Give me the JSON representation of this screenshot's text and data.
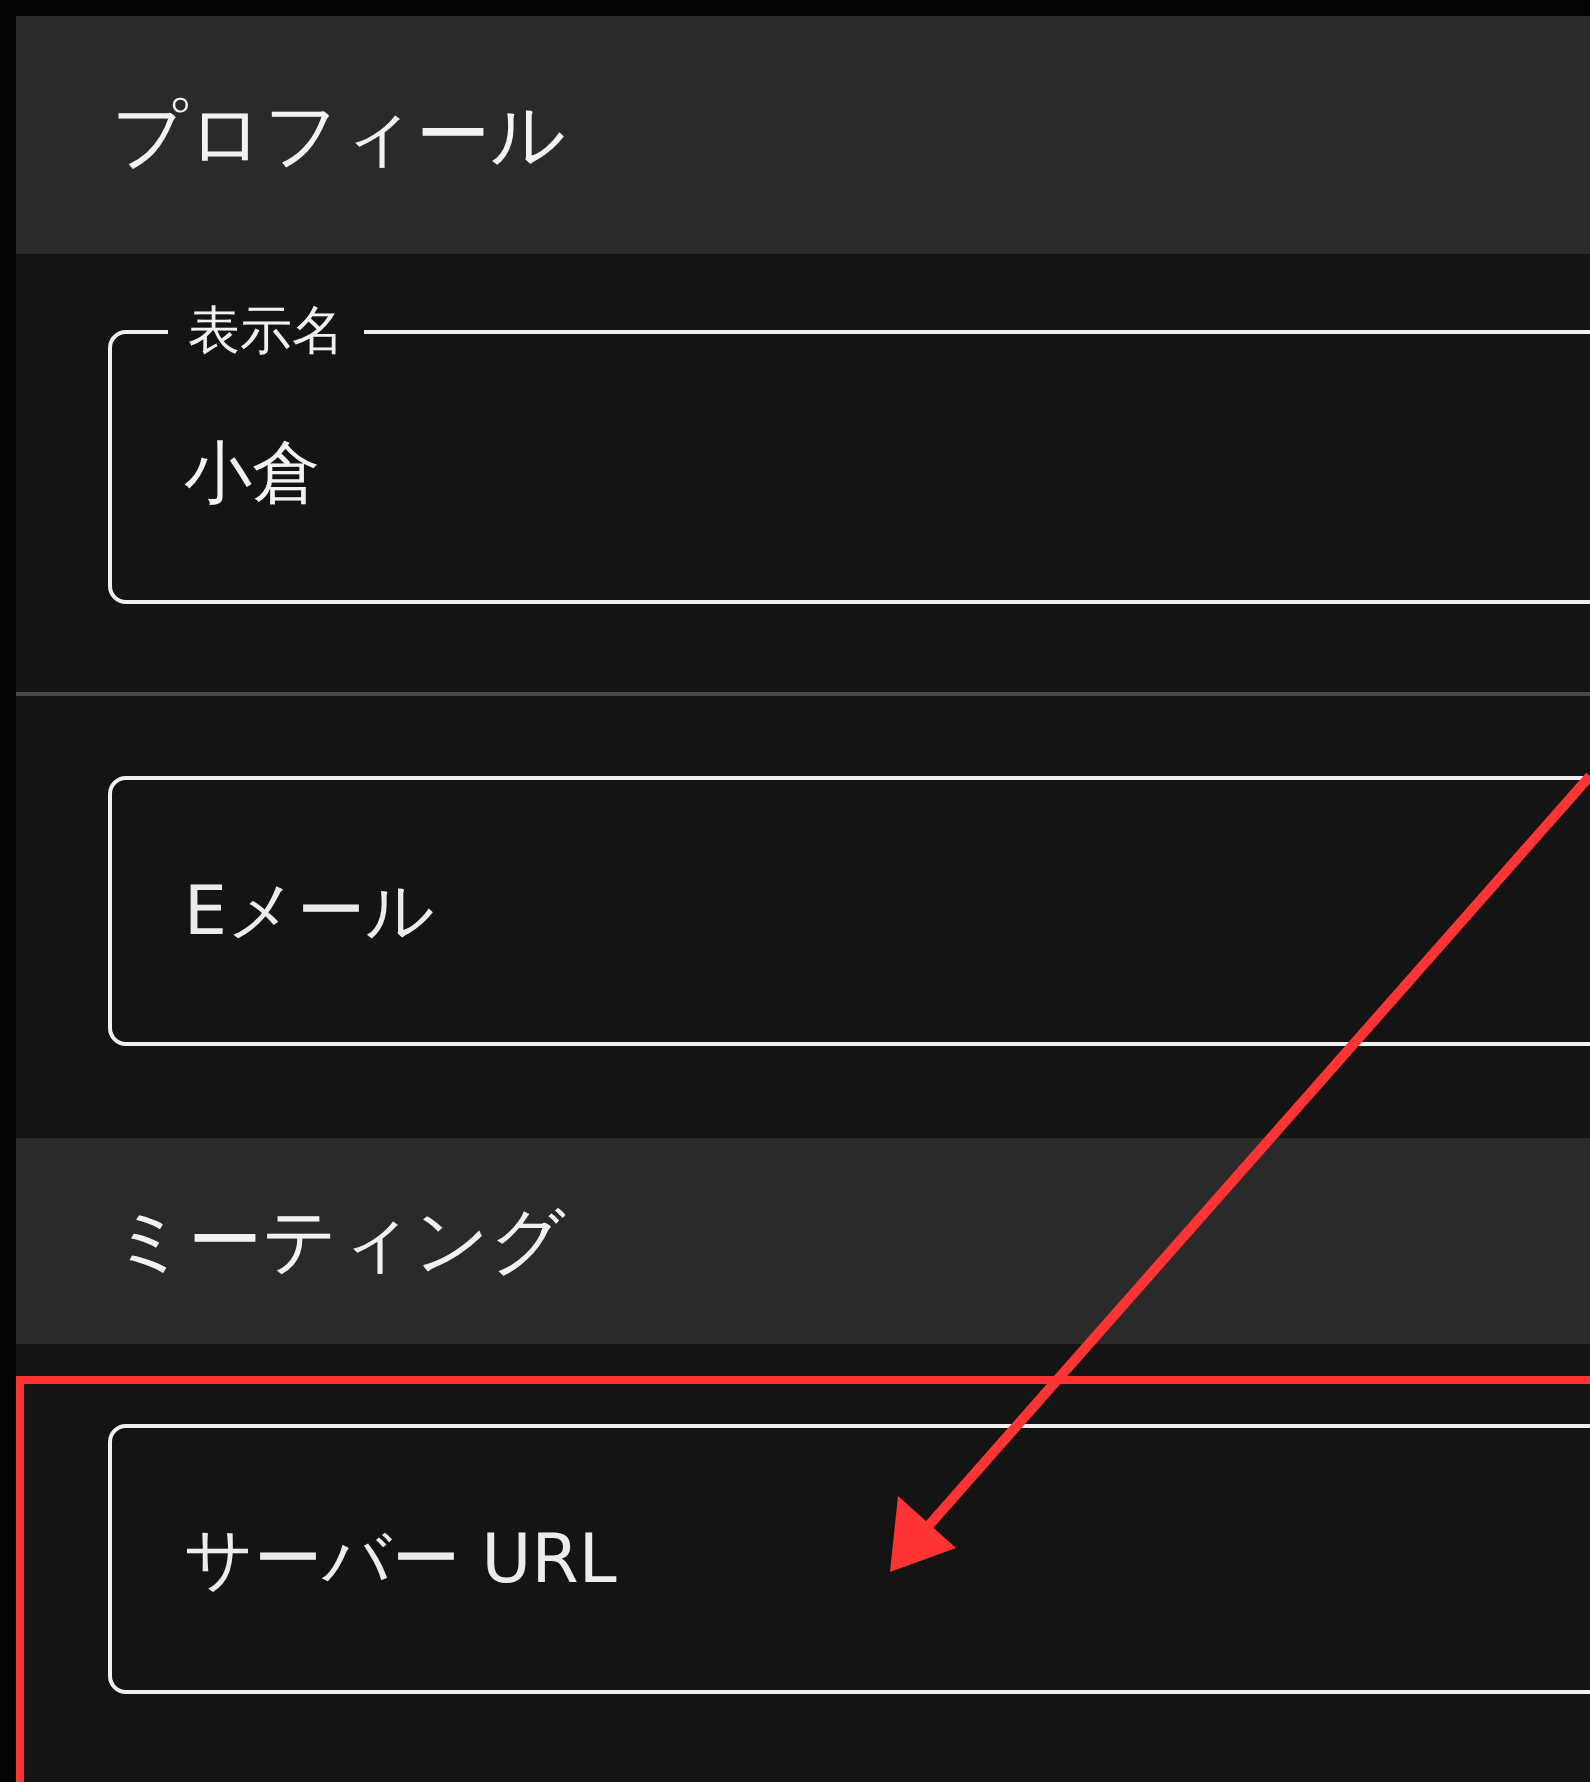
{
  "sections": [
    {
      "title": "プロフィール",
      "fields": [
        {
          "kind": "labeled",
          "label": "表示名",
          "value": "小倉"
        },
        {
          "kind": "empty",
          "placeholder": "Eメール"
        }
      ]
    },
    {
      "title": "ミーティング",
      "fields": [
        {
          "kind": "empty",
          "placeholder": "サーバー URL"
        }
      ]
    }
  ]
}
